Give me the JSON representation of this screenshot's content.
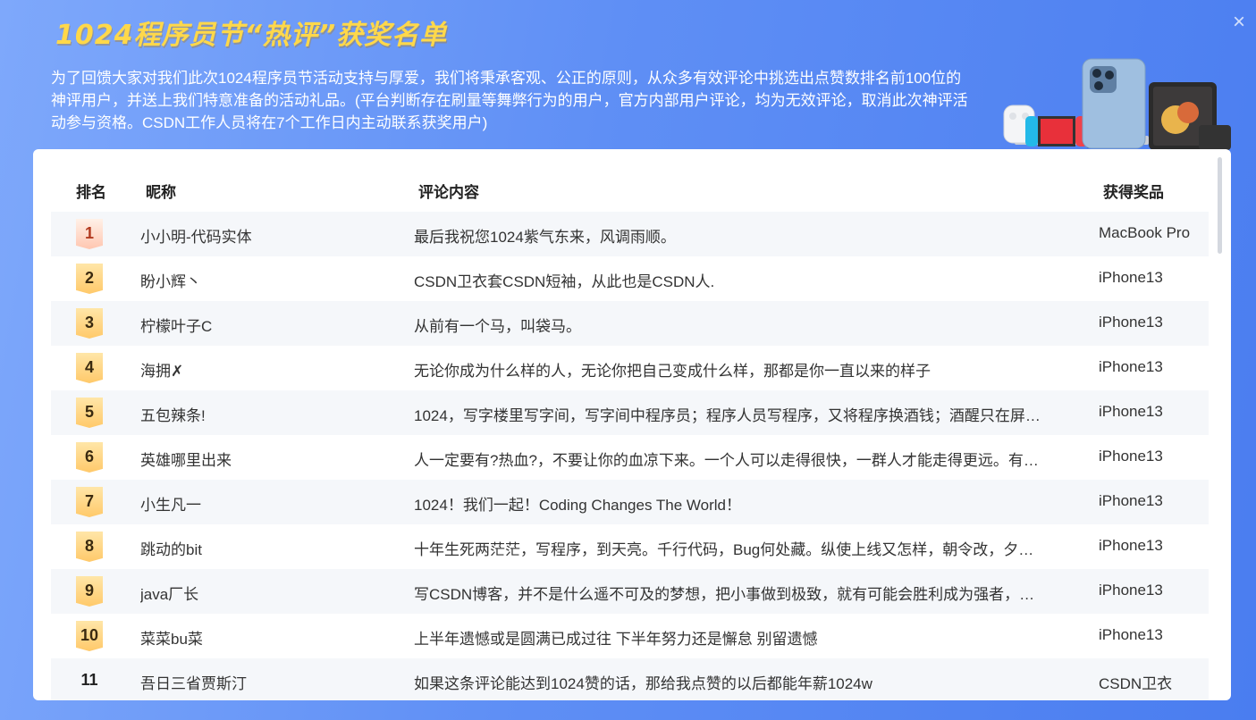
{
  "header": {
    "title": "1024程序员节“热评”获奖名单",
    "close_icon": "close-icon",
    "intro": "为了回馈大家对我们此次1024程序员节活动支持与厚爱，我们将秉承客观、公正的原则，从众多有效评论中挑选出点赞数排名前100位的神评用户，并送上我们特意准备的活动礼品。(平台判断存在刷量等舞弊行为的用户，官方内部用户评论，均为无效评论，取消此次神评活动参与资格。CSDN工作人员将在7个工作日内主动联系获奖用户)"
  },
  "colors": {
    "accent": "#5f8ff5",
    "title": "#ffd84a",
    "badge_gold": "#ffc96a",
    "badge_first": "#ffc6b0"
  },
  "table": {
    "columns": {
      "rank": "排名",
      "name": "昵称",
      "comment": "评论内容",
      "prize": "获得奖品"
    },
    "rows": [
      {
        "rank": "1",
        "name": "小小明-代码实体",
        "comment": "最后我祝您1024紫气东来，风调雨顺。",
        "prize": "MacBook Pro"
      },
      {
        "rank": "2",
        "name": "盼小辉丶",
        "comment": "CSDN卫衣套CSDN短袖，从此也是CSDN人.",
        "prize": "iPhone13"
      },
      {
        "rank": "3",
        "name": "柠檬叶子C",
        "comment": "从前有一个马，叫袋马。",
        "prize": "iPhone13"
      },
      {
        "rank": "4",
        "name": "海拥✗",
        "comment": "无论你成为什么样的人，无论你把自己变成什么样，那都是你一直以来的样子",
        "prize": "iPhone13"
      },
      {
        "rank": "5",
        "name": "五包辣条!",
        "comment": "1024，写字楼里写字间，写字间中程序员；程序人员写程序，又将程序换酒钱；酒醒只在屏…",
        "prize": "iPhone13"
      },
      {
        "rank": "6",
        "name": "英雄哪里出来",
        "comment": "人一定要有?热血?，不要让你的血凉下来。一个人可以走得很快，一群人才能走得更远。有…",
        "prize": "iPhone13"
      },
      {
        "rank": "7",
        "name": "小生凡一",
        "comment": "1024！我们一起！Coding Changes The World！",
        "prize": "iPhone13"
      },
      {
        "rank": "8",
        "name": "跳动的bit",
        "comment": "十年生死两茫茫，写程序，到天亮。千行代码，Bug何处藏。纵使上线又怎样，朝令改，夕…",
        "prize": "iPhone13"
      },
      {
        "rank": "9",
        "name": "java厂长",
        "comment": "写CSDN博客，并不是什么遥不可及的梦想，把小事做到极致，就有可能会胜利成为强者，…",
        "prize": "iPhone13"
      },
      {
        "rank": "10",
        "name": "菜菜bu菜",
        "comment": "上半年遗憾或是圆满已成过往 下半年努力还是懈怠 别留遗憾",
        "prize": "iPhone13"
      },
      {
        "rank": "11",
        "name": "吾日三省贾斯汀",
        "comment": "如果这条评论能达到1024赞的话，那给我点赞的以后都能年薪1024w",
        "prize": "CSDN卫衣"
      }
    ]
  }
}
